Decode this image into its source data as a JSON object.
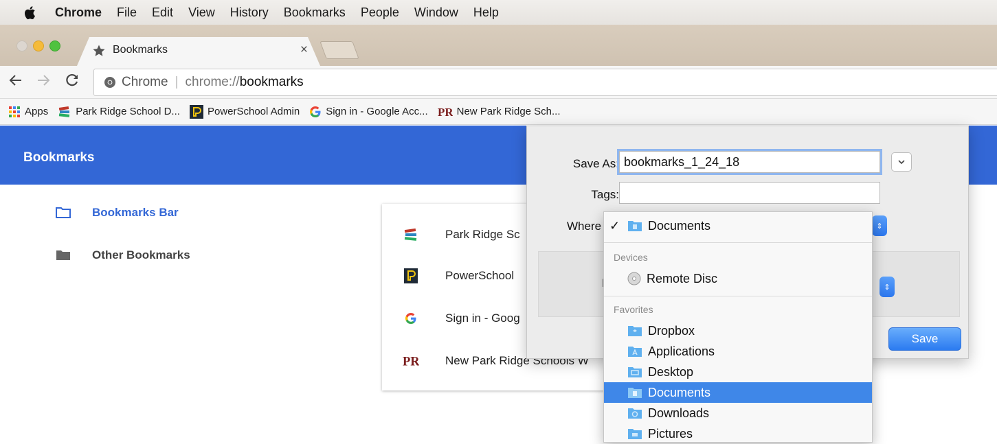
{
  "menubar": {
    "items": [
      {
        "label": "Chrome",
        "bold": true
      },
      {
        "label": "File"
      },
      {
        "label": "Edit"
      },
      {
        "label": "View"
      },
      {
        "label": "History"
      },
      {
        "label": "Bookmarks"
      },
      {
        "label": "People"
      },
      {
        "label": "Window"
      },
      {
        "label": "Help"
      }
    ]
  },
  "tab": {
    "title": "Bookmarks",
    "close": "×"
  },
  "address": {
    "chip": "Chrome",
    "scheme": "chrome://",
    "host": "bookmarks"
  },
  "bookmarks_bar": {
    "apps": "Apps",
    "items": [
      {
        "label": "Park Ridge School D...",
        "icon": "books-icon"
      },
      {
        "label": "PowerSchool Admin",
        "icon": "powerschool-icon"
      },
      {
        "label": "Sign in - Google Acc...",
        "icon": "google-icon"
      },
      {
        "label": "New Park Ridge Sch...",
        "icon": "pr-icon"
      }
    ]
  },
  "page": {
    "title": "Bookmarks"
  },
  "sidebar": {
    "items": [
      {
        "label": "Bookmarks Bar",
        "active": true
      },
      {
        "label": "Other Bookmarks",
        "active": false
      }
    ]
  },
  "list": {
    "items": [
      {
        "label": "Park Ridge Sc",
        "icon": "books-icon"
      },
      {
        "label": "PowerSchool",
        "icon": "powerschool-icon"
      },
      {
        "label": "Sign in - Goog",
        "icon": "google-icon"
      },
      {
        "label": "New Park Ridge Schools W",
        "icon": "pr-icon"
      }
    ]
  },
  "save_dialog": {
    "save_as_label": "Save As:",
    "save_as_value": "bookmarks_1_24_18",
    "tags_label": "Tags:",
    "tags_value": "",
    "where_label": "Where",
    "format_label_partial": "F",
    "save_label": "Save"
  },
  "location_menu": {
    "checkmark": "✓",
    "current": "Documents",
    "devices_heading": "Devices",
    "devices": [
      "Remote Disc"
    ],
    "favorites_heading": "Favorites",
    "favorites": [
      "Dropbox",
      "Applications",
      "Desktop",
      "Documents",
      "Downloads",
      "Pictures"
    ],
    "selected": "Documents"
  },
  "colors": {
    "header_blue": "#3367d6",
    "active_sidebar": "#3367d6",
    "menu_selection": "#3f87e8",
    "save_button": "#2b7bf0"
  }
}
